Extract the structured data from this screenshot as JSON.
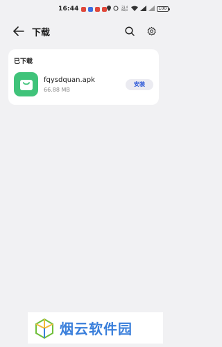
{
  "status_bar": {
    "time": "16:44",
    "signal_text": "23.4 KB/s",
    "battery": "100"
  },
  "header": {
    "title": "下载",
    "back_icon": "arrow-left",
    "search_icon": "search",
    "settings_icon": "gear"
  },
  "downloads": {
    "section_title": "已下载",
    "items": [
      {
        "name": "fqysdquan.apk",
        "size": "66.88 MB",
        "action": "安装",
        "icon": "shopping-bag"
      }
    ]
  },
  "watermark": {
    "text": "烟云软件园"
  },
  "colors": {
    "background": "#f1f1f3",
    "app_icon": "#40c37a",
    "install_text": "#2d59d8",
    "watermark_text": "#3a7fdb"
  }
}
